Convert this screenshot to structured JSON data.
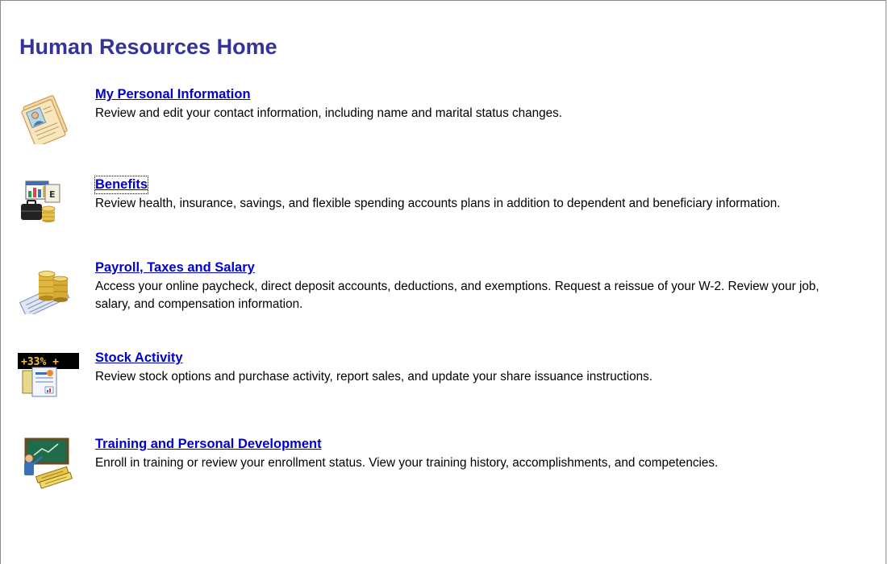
{
  "page": {
    "title": "Human Resources Home"
  },
  "items": [
    {
      "title": "My Personal Information",
      "description": "Review and edit your contact information, including name and marital status changes.",
      "icon": "personal-information-icon"
    },
    {
      "title": "Benefits",
      "description": "Review health, insurance, savings, and flexible spending accounts plans in addition to dependent and beneficiary information.",
      "icon": "benefits-icon"
    },
    {
      "title": "Payroll, Taxes and Salary",
      "description": "Access your online paycheck, direct deposit accounts, deductions, and exemptions. Request a reissue of your W-2. Review your job, salary, and compensation information.",
      "icon": "payroll-coins-icon"
    },
    {
      "title": "Stock Activity",
      "description": "Review stock options and purchase activity, report sales, and update your share issuance instructions.",
      "icon": "stock-ticker-icon",
      "icon_ticker_text": "+33% +"
    },
    {
      "title": "Training and Personal Development",
      "description": "Enroll in training or review your enrollment status. View your training history, accomplishments, and competencies.",
      "icon": "training-chalkboard-icon"
    }
  ],
  "colors": {
    "title": "#333399",
    "link": "#0000cc",
    "text": "#000000",
    "background": "#ffffff"
  }
}
